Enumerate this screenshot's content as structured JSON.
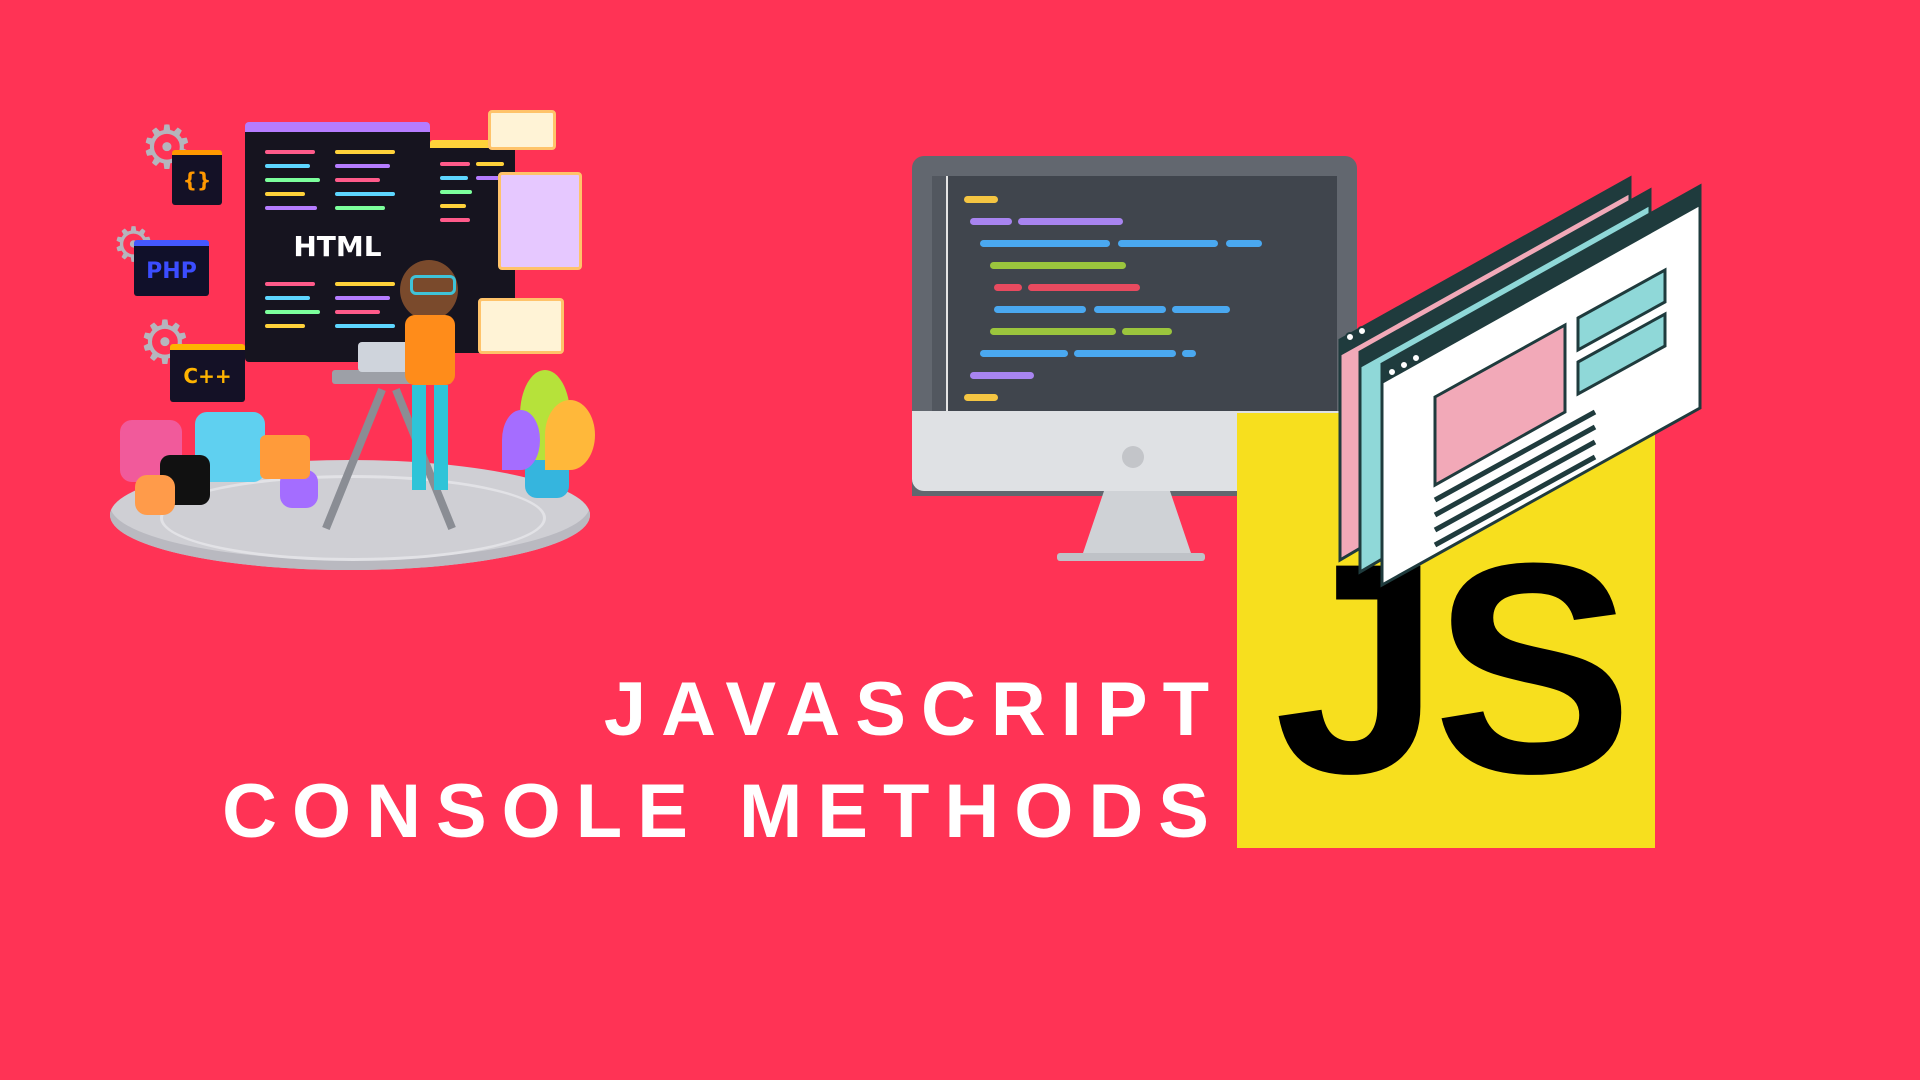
{
  "background_color": "#FF3355",
  "title": {
    "line1": "JAVASCRIPT",
    "line2": "CONSOLE METHODS"
  },
  "logo": {
    "text": "JS",
    "color": "#F7DF1E"
  },
  "illustration": {
    "panel_label": "HTML",
    "chips": {
      "php": "PHP",
      "cpp": "C++",
      "braces": "{}"
    },
    "icons": [
      "gear-icon",
      "phone-icon",
      "headphones-icon",
      "image-icon",
      "user-icon",
      "folder-icon",
      "code-icon",
      "plant-icon",
      "laptop-icon"
    ]
  }
}
